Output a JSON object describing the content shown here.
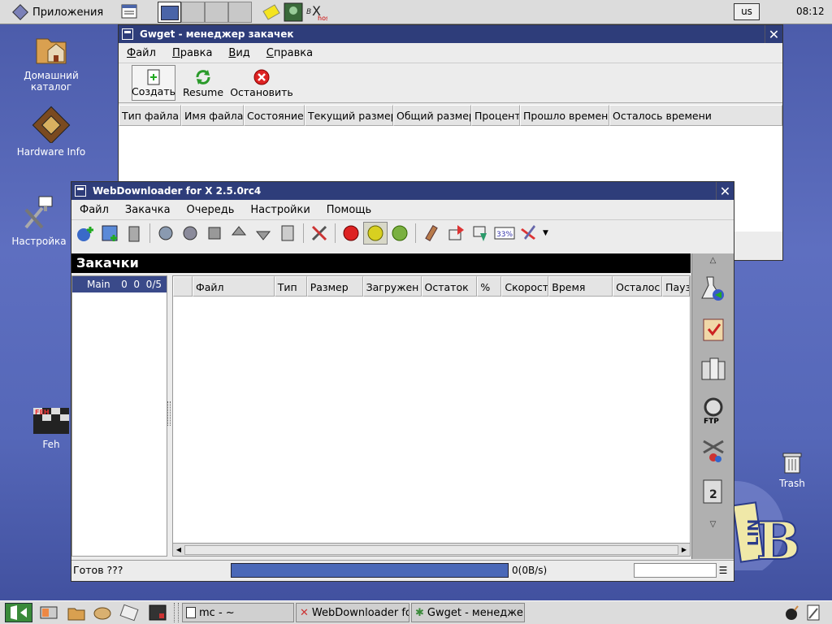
{
  "topbar": {
    "apps_menu": "Приложения",
    "keyboard": "us",
    "clock": "08:12"
  },
  "desktop": {
    "icons": [
      {
        "label": "Домашний каталог"
      },
      {
        "label": "Hardware Info"
      },
      {
        "label": "Настройка"
      },
      {
        "label": "Feh"
      },
      {
        "label": "Trash"
      }
    ]
  },
  "gwget": {
    "title": "Gwget - менеджер закачек",
    "menu": [
      "Файл",
      "Правка",
      "Вид",
      "Справка"
    ],
    "toolbar": {
      "new_label": "Создать",
      "resume_label": "Resume",
      "stop_label": "Остановить"
    },
    "columns": [
      "Тип файла",
      "Имя файла",
      "Состояние",
      "Текущий размер",
      "Общий размер",
      "Процент",
      "Прошло времени",
      "Осталось времени"
    ]
  },
  "wd": {
    "title": "WebDownloader for X 2.5.0rc4",
    "menu": [
      "Файл",
      "Закачка",
      "Очередь",
      "Настройки",
      "Помощь"
    ],
    "section": "Закачки",
    "queue": {
      "name": "Main",
      "counts": "0  0  0/5"
    },
    "columns": [
      "",
      "Файл",
      "Тип",
      "Размер",
      "Загружен",
      "Остаток",
      "%",
      "Скорост",
      "Время",
      "Осталос",
      "Пауз"
    ],
    "status": "Готов ???",
    "speed": "0(0B/s)"
  },
  "taskbar": {
    "tasks": [
      "mc - ~",
      "WebDownloader for",
      "Gwget - менеджер"
    ]
  }
}
